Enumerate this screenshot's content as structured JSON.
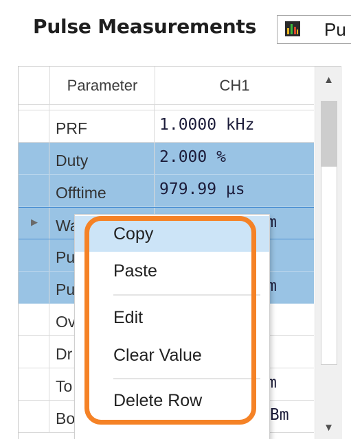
{
  "header": {
    "title": "Pulse Measurements",
    "view_select_value": "Pu",
    "view_select_icon": "chart-icon"
  },
  "grid": {
    "columns": [
      "Parameter",
      "CH1"
    ],
    "rows": [
      {
        "parameter": "",
        "value": "",
        "selected": false
      },
      {
        "parameter": "PRF",
        "value": "1.0000 kHz",
        "selected": false
      },
      {
        "parameter": "Duty",
        "value": "2.000 %",
        "selected": true
      },
      {
        "parameter": "Offtime",
        "value": "979.99 µs",
        "selected": true
      },
      {
        "parameter": "Wa",
        "value": "",
        "tail": "m",
        "selected": true,
        "current": true
      },
      {
        "parameter": "Pu",
        "value": "",
        "tail": "",
        "selected": true
      },
      {
        "parameter": "Pu",
        "value": "",
        "tail": "m",
        "selected": true
      },
      {
        "parameter": "Ov",
        "value": "",
        "tail": "",
        "selected": false
      },
      {
        "parameter": "Dr",
        "value": "",
        "tail": "",
        "selected": false
      },
      {
        "parameter": "To",
        "value": "",
        "tail": "m",
        "selected": false
      },
      {
        "parameter": "Bottom",
        "value": "",
        "tail": "dBm",
        "selected": false
      }
    ]
  },
  "context_menu": {
    "items": [
      {
        "label": "Copy",
        "hover": true
      },
      {
        "label": "Paste",
        "hover": false
      },
      {
        "label": "Edit",
        "hover": false
      },
      {
        "label": "Clear Value",
        "hover": false
      },
      {
        "label": "Delete Row",
        "hover": false
      }
    ]
  },
  "colors": {
    "selection": "#99c3e4",
    "menu_hover": "#cce4f7",
    "highlight_frame": "#f58226"
  }
}
